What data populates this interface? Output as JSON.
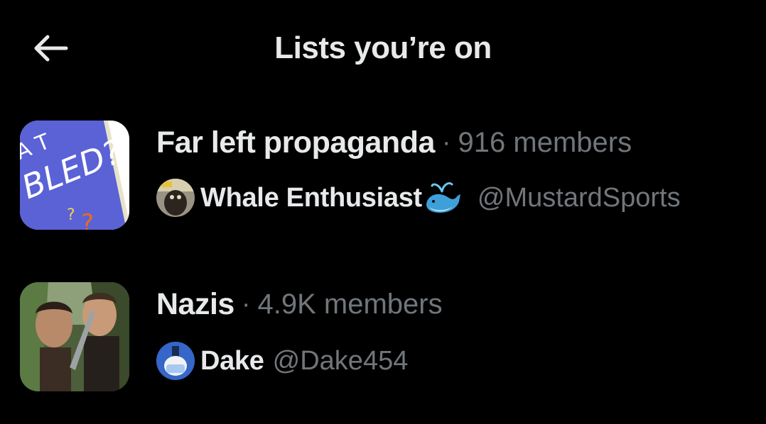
{
  "header": {
    "title": "Lists you’re on",
    "back_icon": "arrow-left-icon"
  },
  "lists": [
    {
      "name": "Far left propaganda",
      "separator": "·",
      "members": "916 members",
      "owner_name": "Whale Enthusiast",
      "owner_handle": "@MustardSports",
      "owner_emoji": "whale-icon"
    },
    {
      "name": "Nazis",
      "separator": "·",
      "members": "4.9K members",
      "owner_name": "Dake",
      "owner_handle": "@Dake454"
    }
  ],
  "colors": {
    "background": "#000000",
    "primary_text": "#e7e9ea",
    "secondary_text": "#71767b"
  }
}
